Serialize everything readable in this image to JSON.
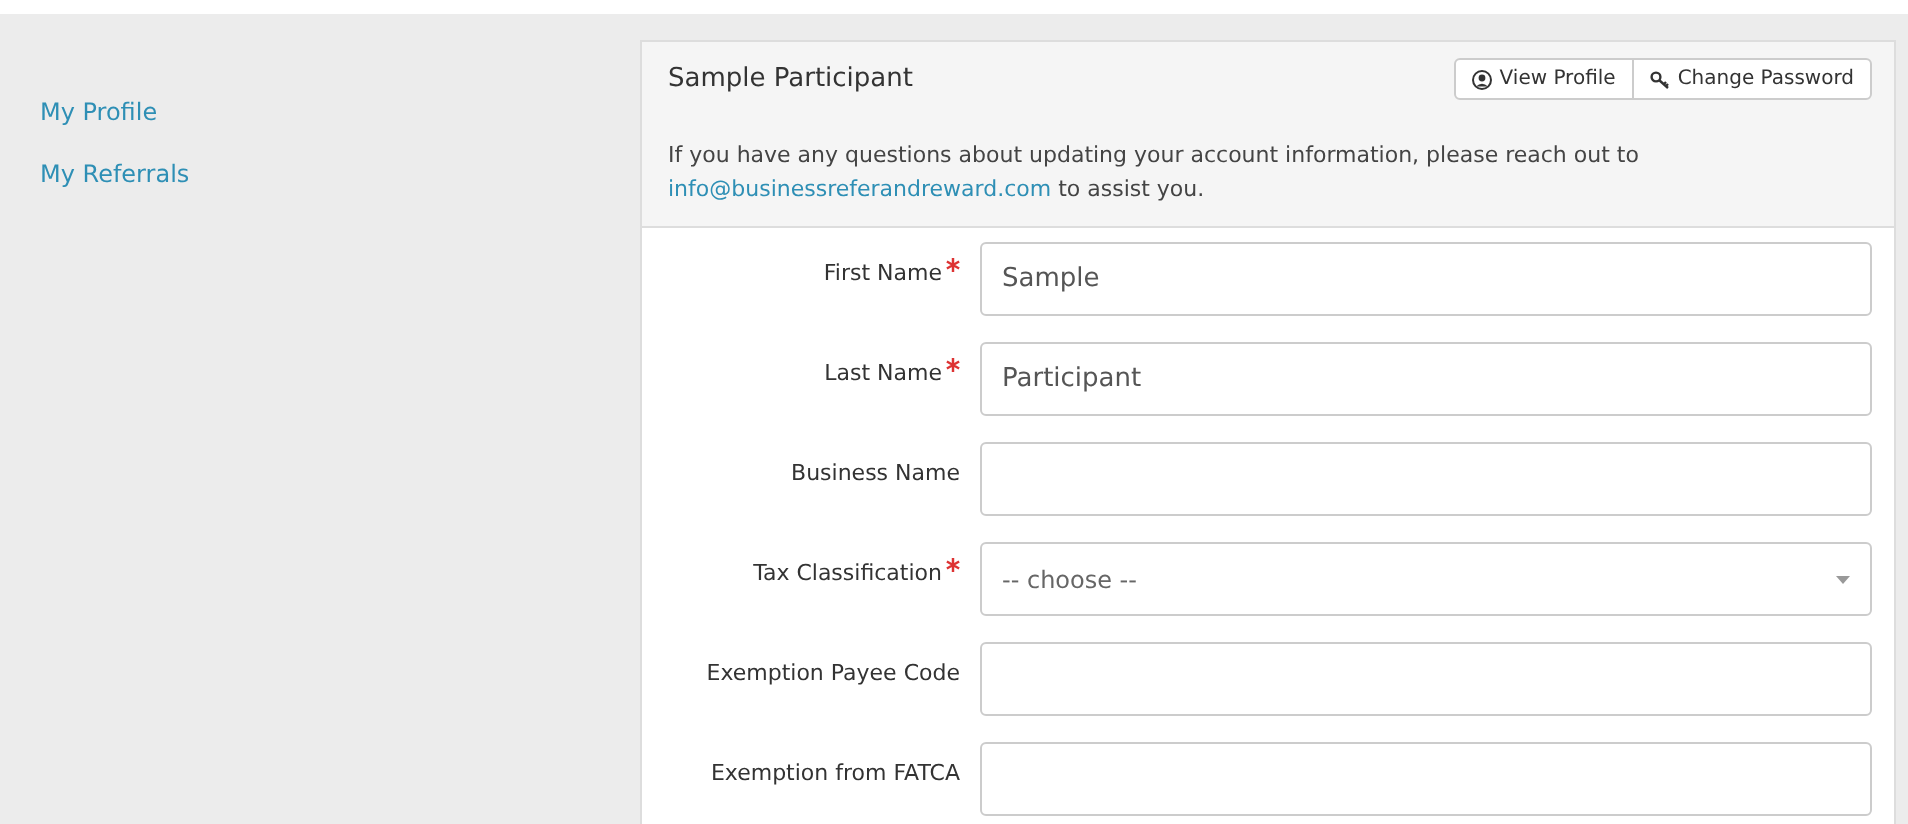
{
  "sidebar": {
    "items": [
      {
        "label": "My Profile"
      },
      {
        "label": "My Referrals"
      }
    ]
  },
  "panel": {
    "title": "Sample Participant",
    "buttons": [
      {
        "label": "View Profile",
        "kind": "profile"
      },
      {
        "label": "Change Password",
        "kind": "password"
      }
    ],
    "notice": {
      "text": "If you have any questions about updating your account information, please reach out to",
      "link": "info@businessreferandreward.com",
      "text_after": "to assist you."
    },
    "fields": [
      {
        "label": "First Name",
        "required": true,
        "kind": "text",
        "value": "Sample"
      },
      {
        "label": "Last Name",
        "required": true,
        "kind": "text",
        "value": "Participant"
      },
      {
        "label": "Business Name",
        "required": false,
        "kind": "text"
      },
      {
        "label": "Tax Classification",
        "required": true,
        "kind": "select",
        "placeholder": "-- choose --"
      },
      {
        "label": "Exemption Payee Code",
        "required": false,
        "kind": "text"
      },
      {
        "label": "Exemption from FATCA",
        "required": false,
        "kind": "text"
      }
    ]
  }
}
